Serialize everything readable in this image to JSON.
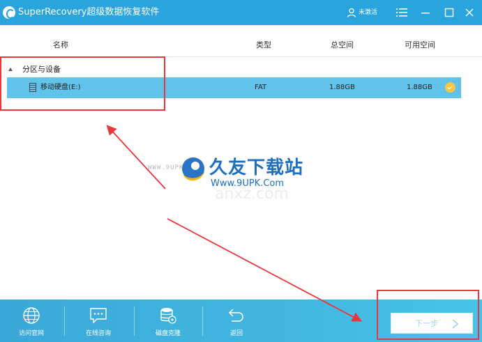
{
  "window": {
    "title": "SuperRecovery超级数据恢复软件",
    "user_status": "未激活",
    "icons": {
      "logo": "app-logo",
      "user": "user-icon",
      "menu": "menu-icon",
      "minimize": "minimize-icon",
      "maximize": "maximize-icon",
      "close": "close-icon"
    }
  },
  "table": {
    "columns": [
      "名称",
      "类型",
      "总空间",
      "可用空间"
    ],
    "group": {
      "label": "分区与设备",
      "expanded": true
    },
    "rows": [
      {
        "name": "移动硬盘(E:)",
        "type": "FAT",
        "total": "1.88GB",
        "free": "1.88GB",
        "selected": true
      }
    ]
  },
  "watermark": {
    "url_left": "WWW.9UPK.COM",
    "brand": "久友下载站",
    "url": "Www.9UPK.Com",
    "faint": "anxz.com"
  },
  "bottombar": {
    "items": [
      {
        "label": "访问官网",
        "icon": "globe-icon"
      },
      {
        "label": "在线咨询",
        "icon": "chat-icon"
      },
      {
        "label": "磁盘克隆",
        "icon": "disk-clone-icon"
      },
      {
        "label": "返回",
        "icon": "back-arrow-icon"
      }
    ],
    "next_label": "下一步"
  },
  "colors": {
    "titlebar": "#2aa4dd",
    "selection": "#62c3ea",
    "check": "#f5c842",
    "annotation": "#e8383d",
    "bottombar": "#3aa8d8"
  }
}
